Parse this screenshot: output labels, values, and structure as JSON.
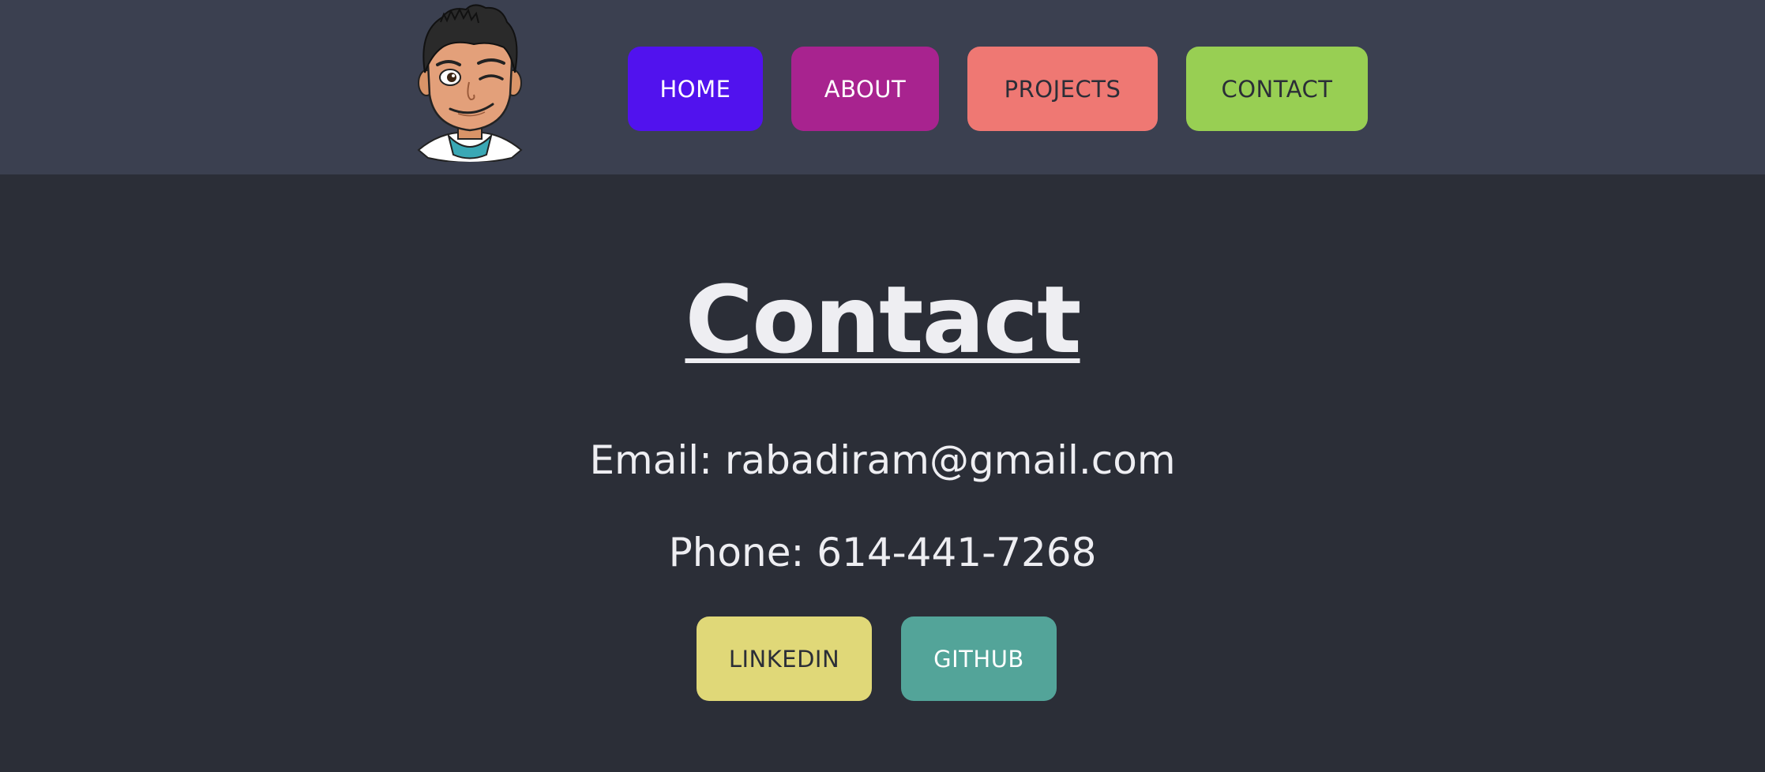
{
  "nav": {
    "items": [
      {
        "label": "HOME",
        "bg": "#5112ee",
        "fg": "#ffffff"
      },
      {
        "label": "ABOUT",
        "bg": "#a8238f",
        "fg": "#ffffff"
      },
      {
        "label": "PROJECTS",
        "bg": "#ef7873",
        "fg": "#2b2e37"
      },
      {
        "label": "CONTACT",
        "bg": "#98cf53",
        "fg": "#2b2e37"
      }
    ]
  },
  "main": {
    "title": "Contact",
    "email": "Email: rabadiram@gmail.com",
    "phone": "Phone: 614-441-7268",
    "links": [
      {
        "label": "LINKEDIN",
        "bg": "#e0d878",
        "fg": "#2b2e37"
      },
      {
        "label": "GITHUB",
        "bg": "#53a499",
        "fg": "#ffffff"
      }
    ]
  },
  "colors": {
    "page_bg": "#2b2e37",
    "navbar_bg": "#3b4050",
    "text": "#eeeef2"
  },
  "icons": {
    "avatar": "cartoon-avatar-winking-man"
  }
}
